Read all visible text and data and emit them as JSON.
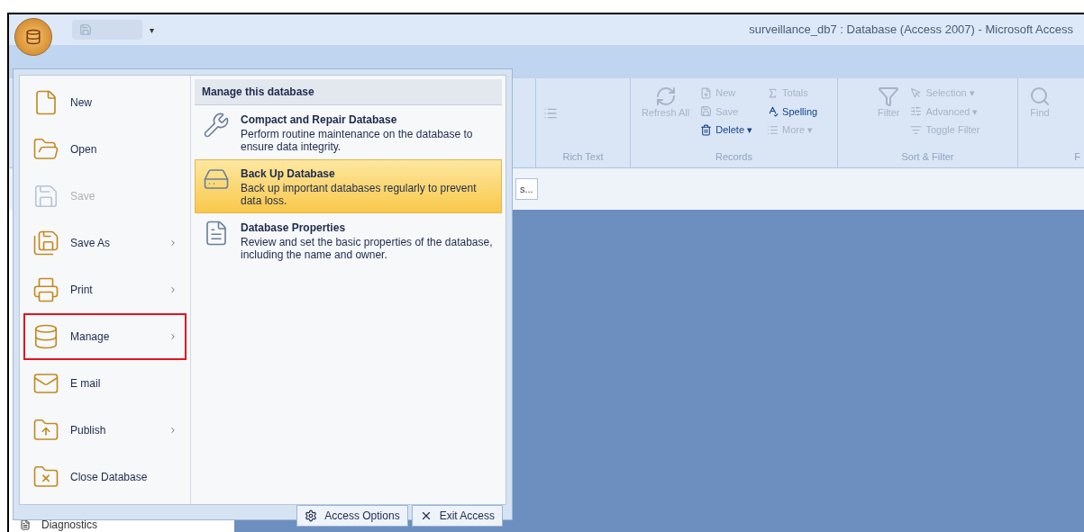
{
  "window": {
    "title": "surveillance_db7 : Database (Access 2007) - Microsoft Access",
    "quick_access": [
      "▾"
    ]
  },
  "ribbon": {
    "groups": [
      {
        "label": "Rich Text",
        "items": [
          {
            "kind": "icon",
            "disabled": true
          }
        ]
      },
      {
        "label": "Records",
        "items": [
          {
            "kind": "large",
            "label": "Refresh All",
            "disabled": true
          },
          {
            "kind": "small",
            "label": "New",
            "disabled": true
          },
          {
            "kind": "small",
            "label": "Save",
            "disabled": true
          },
          {
            "kind": "small",
            "label": "Delete ▾",
            "disabled": false
          },
          {
            "kind": "small",
            "label": "Totals",
            "disabled": true
          },
          {
            "kind": "small",
            "label": "Spelling",
            "disabled": false
          },
          {
            "kind": "small",
            "label": "More ▾",
            "disabled": true
          }
        ]
      },
      {
        "label": "Sort & Filter",
        "items": [
          {
            "kind": "large",
            "label": "Filter",
            "disabled": true
          },
          {
            "kind": "small",
            "label": "Selection ▾",
            "disabled": true
          },
          {
            "kind": "small",
            "label": "Advanced ▾",
            "disabled": true
          },
          {
            "kind": "small",
            "label": "Toggle Filter",
            "disabled": true
          }
        ]
      },
      {
        "label": "F",
        "items": [
          {
            "kind": "large",
            "label": "Find",
            "disabled": true
          }
        ]
      }
    ]
  },
  "search_button": {
    "label": "s..."
  },
  "nav_pane": {
    "items": [
      {
        "label": "Diagnostics"
      }
    ]
  },
  "office_menu": {
    "items": [
      {
        "label": "New",
        "disabled": false,
        "submenu": false,
        "selected": false
      },
      {
        "label": "Open",
        "disabled": false,
        "submenu": false,
        "selected": false
      },
      {
        "label": "Save",
        "disabled": true,
        "submenu": false,
        "selected": false
      },
      {
        "label": "Save As",
        "disabled": false,
        "submenu": true,
        "selected": false
      },
      {
        "label": "Print",
        "disabled": false,
        "submenu": true,
        "selected": false
      },
      {
        "label": "Manage",
        "disabled": false,
        "submenu": true,
        "selected": true
      },
      {
        "label": "E mail",
        "disabled": false,
        "submenu": false,
        "selected": false
      },
      {
        "label": "Publish",
        "disabled": false,
        "submenu": true,
        "selected": false
      },
      {
        "label": "Close Database",
        "disabled": false,
        "submenu": false,
        "selected": false
      }
    ],
    "panel": {
      "title": "Manage this database",
      "items": [
        {
          "title": "Compact and Repair Database",
          "description": "Perform routine maintenance on the database to ensure data integrity.",
          "selected": false
        },
        {
          "title": "Back Up Database",
          "description": "Back up important databases regularly to prevent data loss.",
          "selected": true
        },
        {
          "title": "Database Properties",
          "description": "Review and set the basic properties of the database, including the name and owner.",
          "selected": false
        }
      ]
    },
    "footer_buttons": [
      {
        "label": "Access Options"
      },
      {
        "label": "Exit Access"
      }
    ]
  }
}
